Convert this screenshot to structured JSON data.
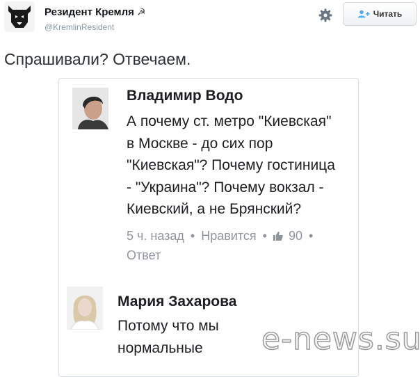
{
  "account": {
    "name": "Резидент Кремля",
    "hammer_sickle": "☭",
    "handle": "@KremlinResident",
    "avatar_icon": "bear-icon"
  },
  "toolbar": {
    "settings_icon": "gear-icon",
    "follow_icon": "add-user-icon",
    "follow_label": "Читать"
  },
  "tweet": {
    "text": "Спрашивали? Отвечаем."
  },
  "embedded_post": {
    "comment": {
      "author": "Владимир Водо",
      "lines": [
        "А почему ст. метро \"Киевская\"",
        "в Москве - до сих пор",
        "\"Киевская\"? Почему гостиница",
        "- \"Украина\"? Почему вокзал -",
        "Киевский, а не Брянский?"
      ],
      "time": "5 ч. назад",
      "like_label": "Нравится",
      "like_count": "90",
      "reply_label": "Ответ",
      "separator": "•"
    },
    "reply": {
      "author": "Мария Захарова",
      "lines": [
        "Потому что мы",
        "нормальные"
      ]
    }
  },
  "watermark": "e-news.su"
}
